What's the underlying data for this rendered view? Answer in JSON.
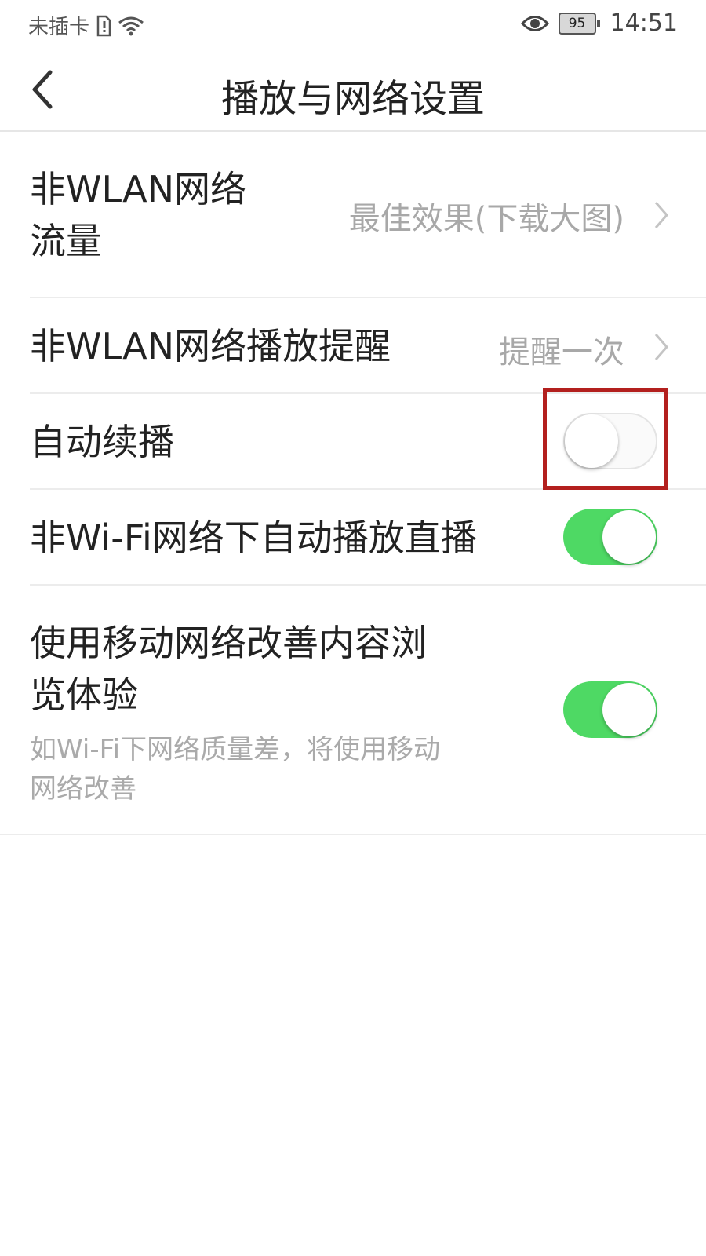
{
  "status_bar": {
    "carrier": "未插卡",
    "sim_icon": "sim-alert-icon",
    "wifi_icon": "wifi-icon",
    "eye_icon": "eye-icon",
    "battery": "95",
    "time": "14:51"
  },
  "header": {
    "back_icon": "chevron-left-icon",
    "title": "播放与网络设置"
  },
  "settings": [
    {
      "label_line1": "非WLAN网络",
      "label_line2": "流量",
      "value": "最佳效果(下载大图)"
    },
    {
      "label": "非WLAN网络播放提醒",
      "value": "提醒一次"
    },
    {
      "label": "自动续播",
      "toggle": false
    },
    {
      "label": "非Wi-Fi网络下自动播放直播",
      "toggle": true
    },
    {
      "label_line1": "使用移动网络改善内容浏",
      "label_line2": "览体验",
      "description_line1": "如Wi-Fi下网络质量差，将使用移动",
      "description_line2": "网络改善",
      "toggle": true
    }
  ],
  "colors": {
    "toggle_on": "#4ed964",
    "highlight_box": "#b3201e"
  }
}
